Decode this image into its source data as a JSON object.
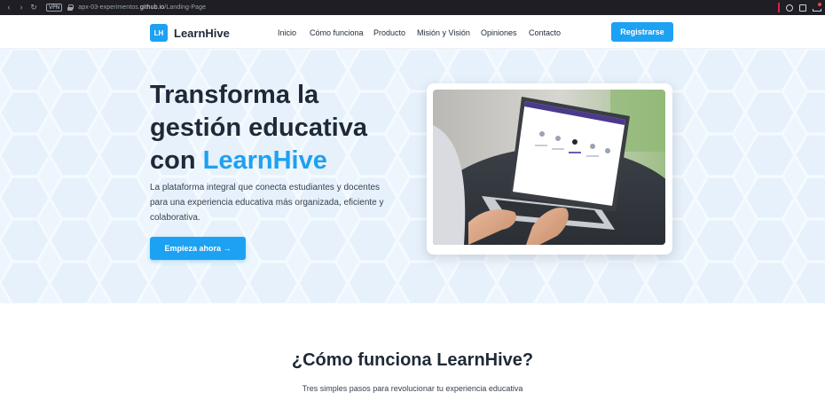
{
  "browser": {
    "vpn_label": "VPN",
    "url_prefix": "apx-03-experimentos.",
    "url_domain": "github.io",
    "url_path": "/Landing-Page"
  },
  "header": {
    "logo_initials": "LH",
    "brand": "LearnHive",
    "nav": [
      "Inicio",
      "Cómo funciona",
      "Producto",
      "Misión y Visión",
      "Opiniones",
      "Contacto"
    ],
    "register_label": "Registrarse"
  },
  "hero": {
    "title_line1": "Transforma la",
    "title_line2": "gestión educativa",
    "title_line3_prefix": "con ",
    "title_accent": "LearnHive",
    "description": "La plataforma integral que conecta estudiantes y docentes para una experiencia educativa más organizada, eficiente y colaborativa.",
    "cta_label": "Empieza ahora →"
  },
  "section": {
    "title": "¿Cómo funciona LearnHive?",
    "subtitle": "Tres simples pasos para revolucionar tu experiencia educativa"
  },
  "colors": {
    "accent": "#1da1f2",
    "hero_bg": "#eef6fd",
    "text_dark": "#1f2937"
  }
}
